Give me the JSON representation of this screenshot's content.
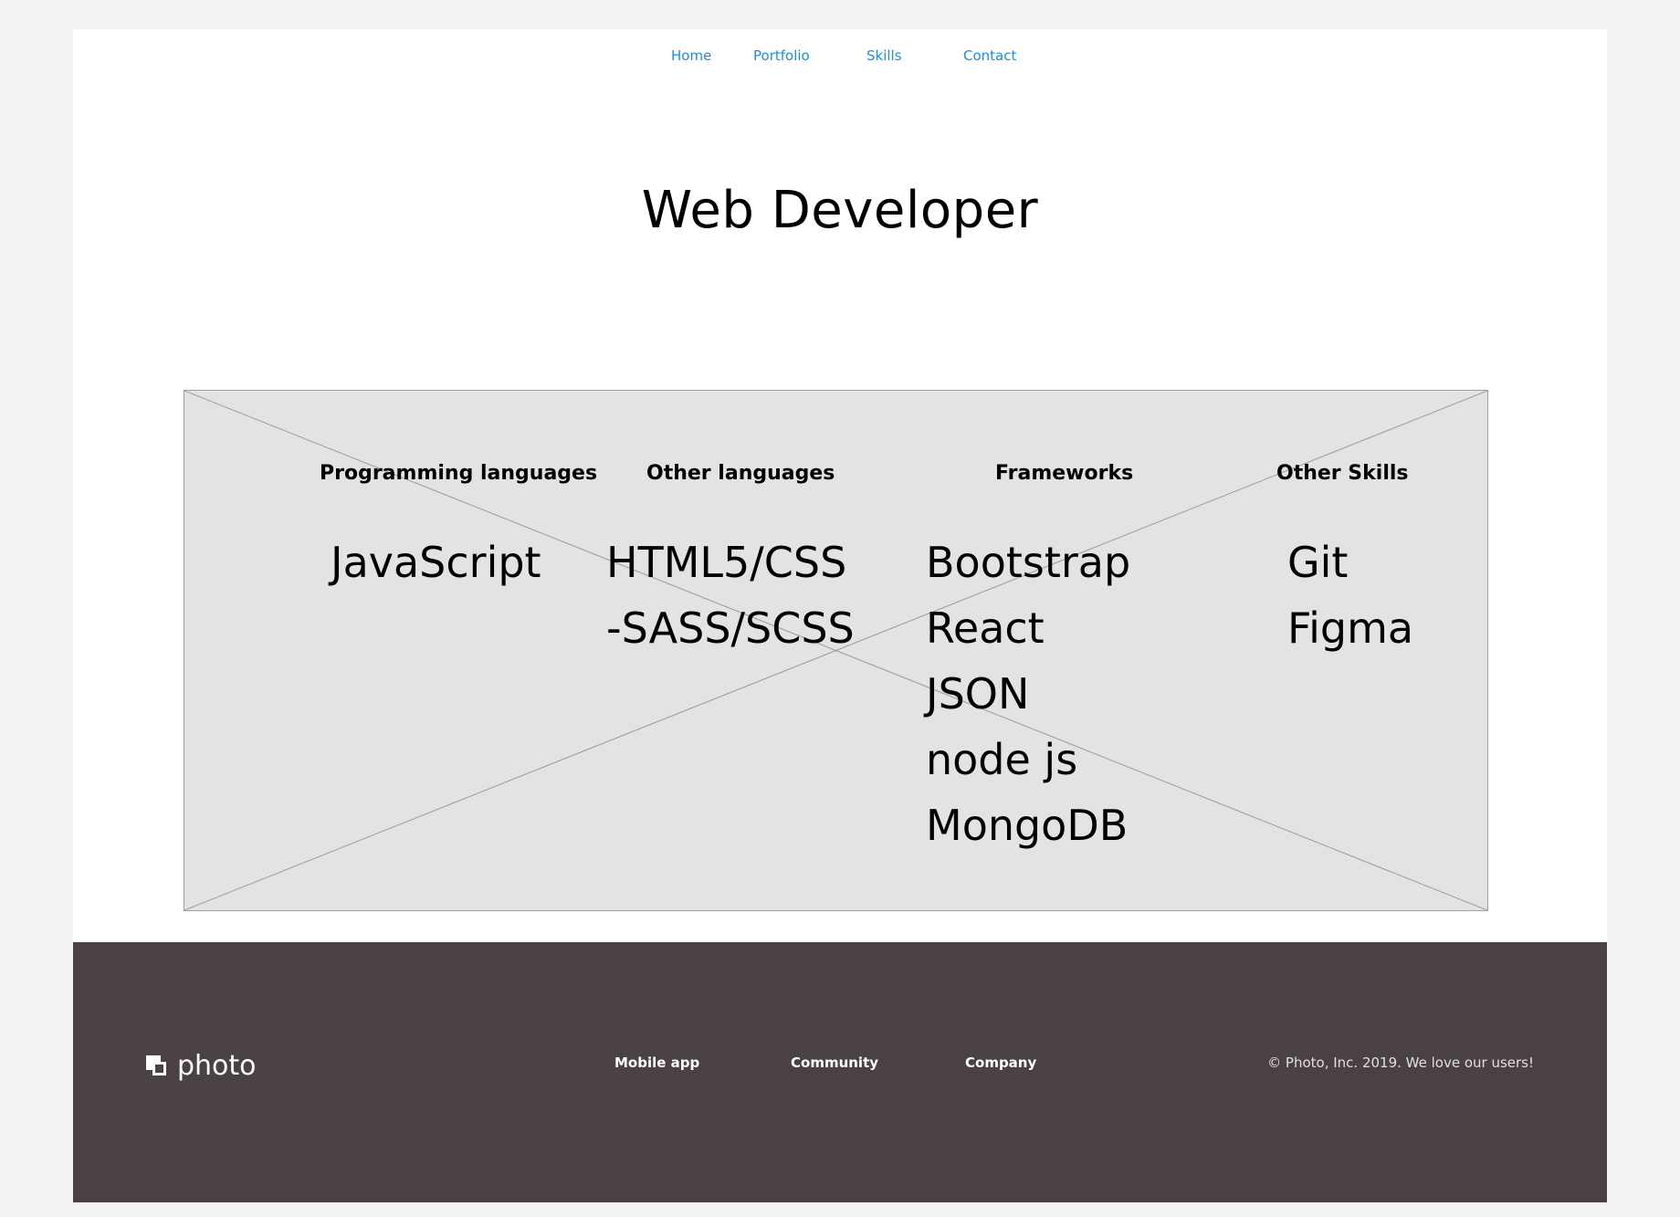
{
  "nav": {
    "home": "Home",
    "portfolio": "Portfolio",
    "skills": "Skills",
    "contact": "Contact"
  },
  "hero": {
    "title": "Web Developer"
  },
  "skills": {
    "columns": [
      {
        "title": "Programming languages",
        "items": [
          "JavaScript"
        ]
      },
      {
        "title": "Other languages",
        "items": [
          "HTML5/CSS",
          "-SASS/SCSS"
        ]
      },
      {
        "title": "Frameworks",
        "items": [
          "Bootstrap",
          "React",
          "JSON",
          "node js",
          "MongoDB"
        ]
      },
      {
        "title": "Other Skills",
        "items": [
          "Git",
          "Figma"
        ]
      }
    ]
  },
  "footer": {
    "logo_text": "photo",
    "links": [
      "Mobile app",
      "Community",
      "Company"
    ],
    "copyright": "© Photo, Inc. 2019. We love our users!"
  },
  "colors": {
    "background": "#f2f2f2",
    "page": "#ffffff",
    "nav_link": "#1a8ee0",
    "placeholder_fill": "#e3e3e3",
    "footer": "#4a4242"
  }
}
